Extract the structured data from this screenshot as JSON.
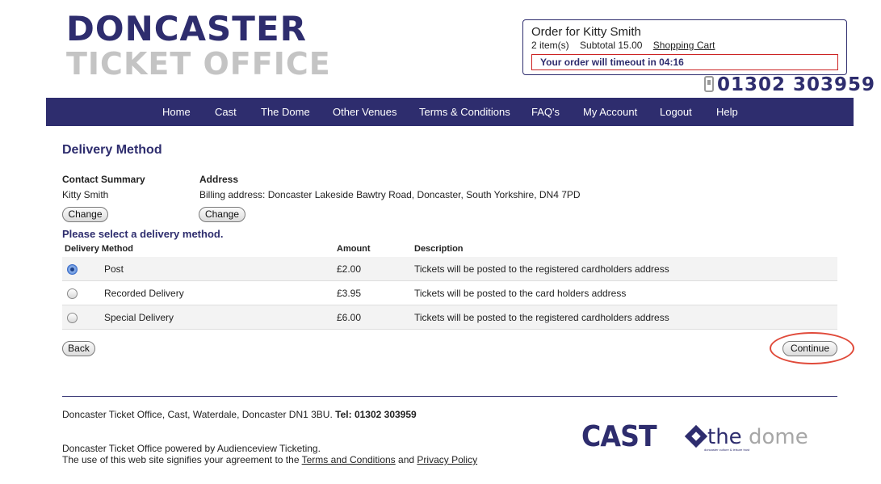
{
  "header": {
    "brand_line1": "DONCASTER",
    "brand_line2": "TICKET OFFICE",
    "order": {
      "title": "Order for Kitty Smith",
      "items": "2 item(s)",
      "subtotal": "Subtotal 15.00",
      "cart_link": "Shopping Cart",
      "timeout": "Your order will timeout in 04:16"
    },
    "phone": "01302 303959"
  },
  "nav": [
    "Home",
    "Cast",
    "The Dome",
    "Other Venues",
    "Terms & Conditions",
    "FAQ's",
    "My Account",
    "Logout",
    "Help"
  ],
  "page": {
    "title": "Delivery Method",
    "contact": {
      "label": "Contact Summary",
      "value": "Kitty Smith",
      "change": "Change"
    },
    "address": {
      "label": "Address",
      "value": "Billing address: Doncaster Lakeside Bawtry Road, Doncaster, South Yorkshire, DN4 7PD",
      "change": "Change"
    },
    "prompt": "Please select a delivery method.",
    "table": {
      "headers": [
        "Delivery Method",
        "Amount",
        "Description"
      ],
      "rows": [
        {
          "method": "Post",
          "amount": "£2.00",
          "description": "Tickets will be posted to the registered cardholders address",
          "selected": true
        },
        {
          "method": "Recorded Delivery",
          "amount": "£3.95",
          "description": "Tickets will be posted to the card holders address",
          "selected": false
        },
        {
          "method": "Special Delivery",
          "amount": "£6.00",
          "description": "Tickets will be posted to the registered cardholders address",
          "selected": false
        }
      ]
    },
    "back": "Back",
    "continue": "Continue",
    "highlight_color": "#e04a3a"
  },
  "footer": {
    "address": "Doncaster Ticket Office, Cast, Waterdale, Doncaster DN1 3BU.",
    "tel_label": "Tel:",
    "tel": "01302 303959",
    "powered": "Doncaster Ticket Office powered by Audienceview Ticketing.",
    "agreement_prefix": "The use of this web site signifies your agreement to the",
    "terms_link": "Terms and Conditions",
    "and": "and",
    "privacy_link": "Privacy Policy",
    "logo_cast": "CAST",
    "logo_the": "the",
    "logo_dome": "dome",
    "logo_dome_sub": "doncaster culture & leisure trust"
  },
  "colors": {
    "brand_navy": "#2e2d6e",
    "brand_grey": "#c4c4c4",
    "alert_red": "#cc2222"
  }
}
